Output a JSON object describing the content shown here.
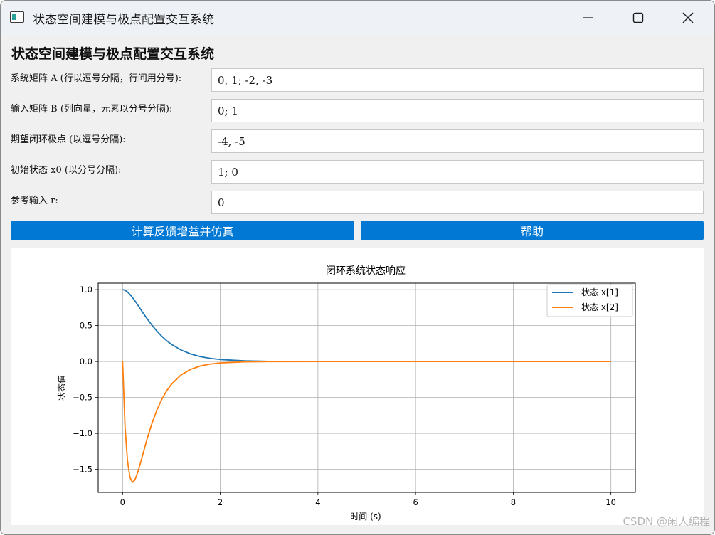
{
  "window": {
    "title": "状态空间建模与极点配置交互系统",
    "icon": "app-window-icon"
  },
  "heading": "状态空间建模与极点配置交互系统",
  "form": {
    "rows": [
      {
        "label": "系统矩阵 A (行以逗号分隔，行间用分号):",
        "value": "0, 1; -2, -3"
      },
      {
        "label": "输入矩阵 B (列向量，元素以分号分隔):",
        "value": "0; 1"
      },
      {
        "label": "期望闭环极点 (以逗号分隔):",
        "value": "-4, -5"
      },
      {
        "label": "初始状态 x0 (以分号分隔):",
        "value": "1; 0"
      },
      {
        "label": "参考输入 r:",
        "value": "0"
      }
    ]
  },
  "buttons": {
    "compute": "计算反馈增益并仿真",
    "help": "帮助"
  },
  "colors": {
    "button": "#0078d4",
    "series1": "#1f77b4",
    "series2": "#ff7f0e"
  },
  "chart_data": {
    "type": "line",
    "title": "闭环系统状态响应",
    "xlabel": "时间 (s)",
    "ylabel": "状态值",
    "xlim": [
      -0.5,
      10.5
    ],
    "ylim": [
      -1.82,
      1.09
    ],
    "xticks": [
      0,
      2,
      4,
      6,
      8,
      10
    ],
    "yticks": [
      1.0,
      0.5,
      0.0,
      -0.5,
      -1.0,
      -1.5
    ],
    "ytick_labels": [
      "1.0",
      "0.5",
      "0.0",
      "−0.5",
      "−1.0",
      "−1.5"
    ],
    "grid": true,
    "legend_position": "top-right",
    "x": [
      0,
      0.05,
      0.1,
      0.15,
      0.2,
      0.25,
      0.3,
      0.35,
      0.4,
      0.5,
      0.6,
      0.7,
      0.8,
      0.9,
      1.0,
      1.2,
      1.4,
      1.6,
      1.8,
      2.0,
      2.5,
      3.0,
      4.0,
      5.0,
      6.0,
      7.0,
      8.0,
      9.0,
      10.0
    ],
    "series": [
      {
        "name": "状态 x[1]",
        "values": [
          1.0,
          0.992,
          0.968,
          0.934,
          0.893,
          0.846,
          0.797,
          0.746,
          0.695,
          0.597,
          0.506,
          0.425,
          0.353,
          0.291,
          0.239,
          0.159,
          0.104,
          0.067,
          0.043,
          0.028,
          0.009,
          0.002,
          0.0,
          0.0,
          0.0,
          0.0,
          0.0,
          0.0,
          0.0
        ]
      },
      {
        "name": "状态 x[2]",
        "values": [
          0.0,
          -0.906,
          -1.38,
          -1.61,
          -1.68,
          -1.65,
          -1.56,
          -1.45,
          -1.33,
          -1.08,
          -0.863,
          -0.68,
          -0.53,
          -0.41,
          -0.316,
          -0.185,
          -0.107,
          -0.061,
          -0.035,
          -0.02,
          -0.005,
          -0.001,
          0.0,
          0.0,
          0.0,
          0.0,
          0.0,
          0.0,
          0.0
        ]
      }
    ]
  },
  "watermark": "CSDN @闲人编程"
}
